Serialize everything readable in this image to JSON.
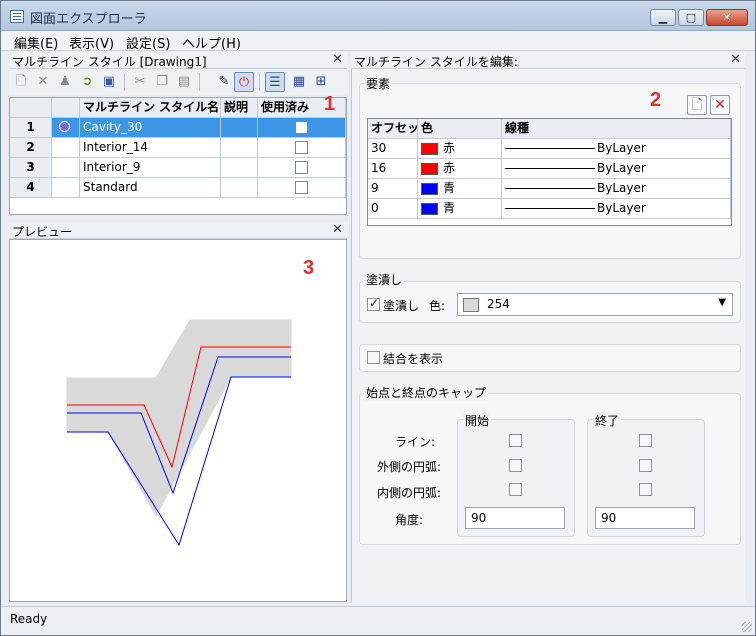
{
  "window": {
    "title": "図面エクスプローラ"
  },
  "menu": [
    "編集(E)",
    "表示(V)",
    "設定(S)",
    "ヘルプ(H)"
  ],
  "left_panel": {
    "title": "マルチライン スタイル [Drawing1]",
    "columns": [
      "マルチライン スタイル名",
      "説明",
      "使用済み"
    ],
    "rows": [
      {
        "num": "1",
        "name": "Cavity_30",
        "desc": "",
        "used": false,
        "selected": true
      },
      {
        "num": "2",
        "name": "Interior_14",
        "desc": "",
        "used": false
      },
      {
        "num": "3",
        "name": "Interior_9",
        "desc": "",
        "used": false
      },
      {
        "num": "4",
        "name": "Standard",
        "desc": "",
        "used": false
      }
    ]
  },
  "preview": {
    "title": "プレビュー"
  },
  "right_panel": {
    "title": "マルチライン スタイルを編集:",
    "elements": {
      "label": "要素",
      "columns": [
        "オフセット",
        "色",
        "線種"
      ],
      "rows": [
        {
          "offset": "30",
          "color_name": "赤",
          "color": "#ff0000",
          "linetype": "ByLayer"
        },
        {
          "offset": "16",
          "color_name": "赤",
          "color": "#ff0000",
          "linetype": "ByLayer"
        },
        {
          "offset": "9",
          "color_name": "青",
          "color": "#0000ff",
          "linetype": "ByLayer"
        },
        {
          "offset": "0",
          "color_name": "青",
          "color": "#0000ff",
          "linetype": "ByLayer"
        }
      ]
    },
    "fill": {
      "label": "塗潰し",
      "checkbox_label": "塗潰し",
      "checked": true,
      "color_label": "色:",
      "color_value": "254",
      "swatch": "#d9d9d9"
    },
    "joints": {
      "checkbox_label": "結合を表示",
      "checked": false
    },
    "caps": {
      "label": "始点と終点のキャップ",
      "start_label": "開始",
      "end_label": "終了",
      "row_labels": [
        "ライン:",
        "外側の円弧:",
        "内側の円弧:",
        "角度:"
      ],
      "start_angle": "90",
      "end_angle": "90"
    }
  },
  "callouts": [
    "1",
    "2",
    "3"
  ],
  "status": {
    "text": "Ready"
  },
  "colors": {
    "selection": "#3d95e6",
    "callout": "#e03030"
  }
}
